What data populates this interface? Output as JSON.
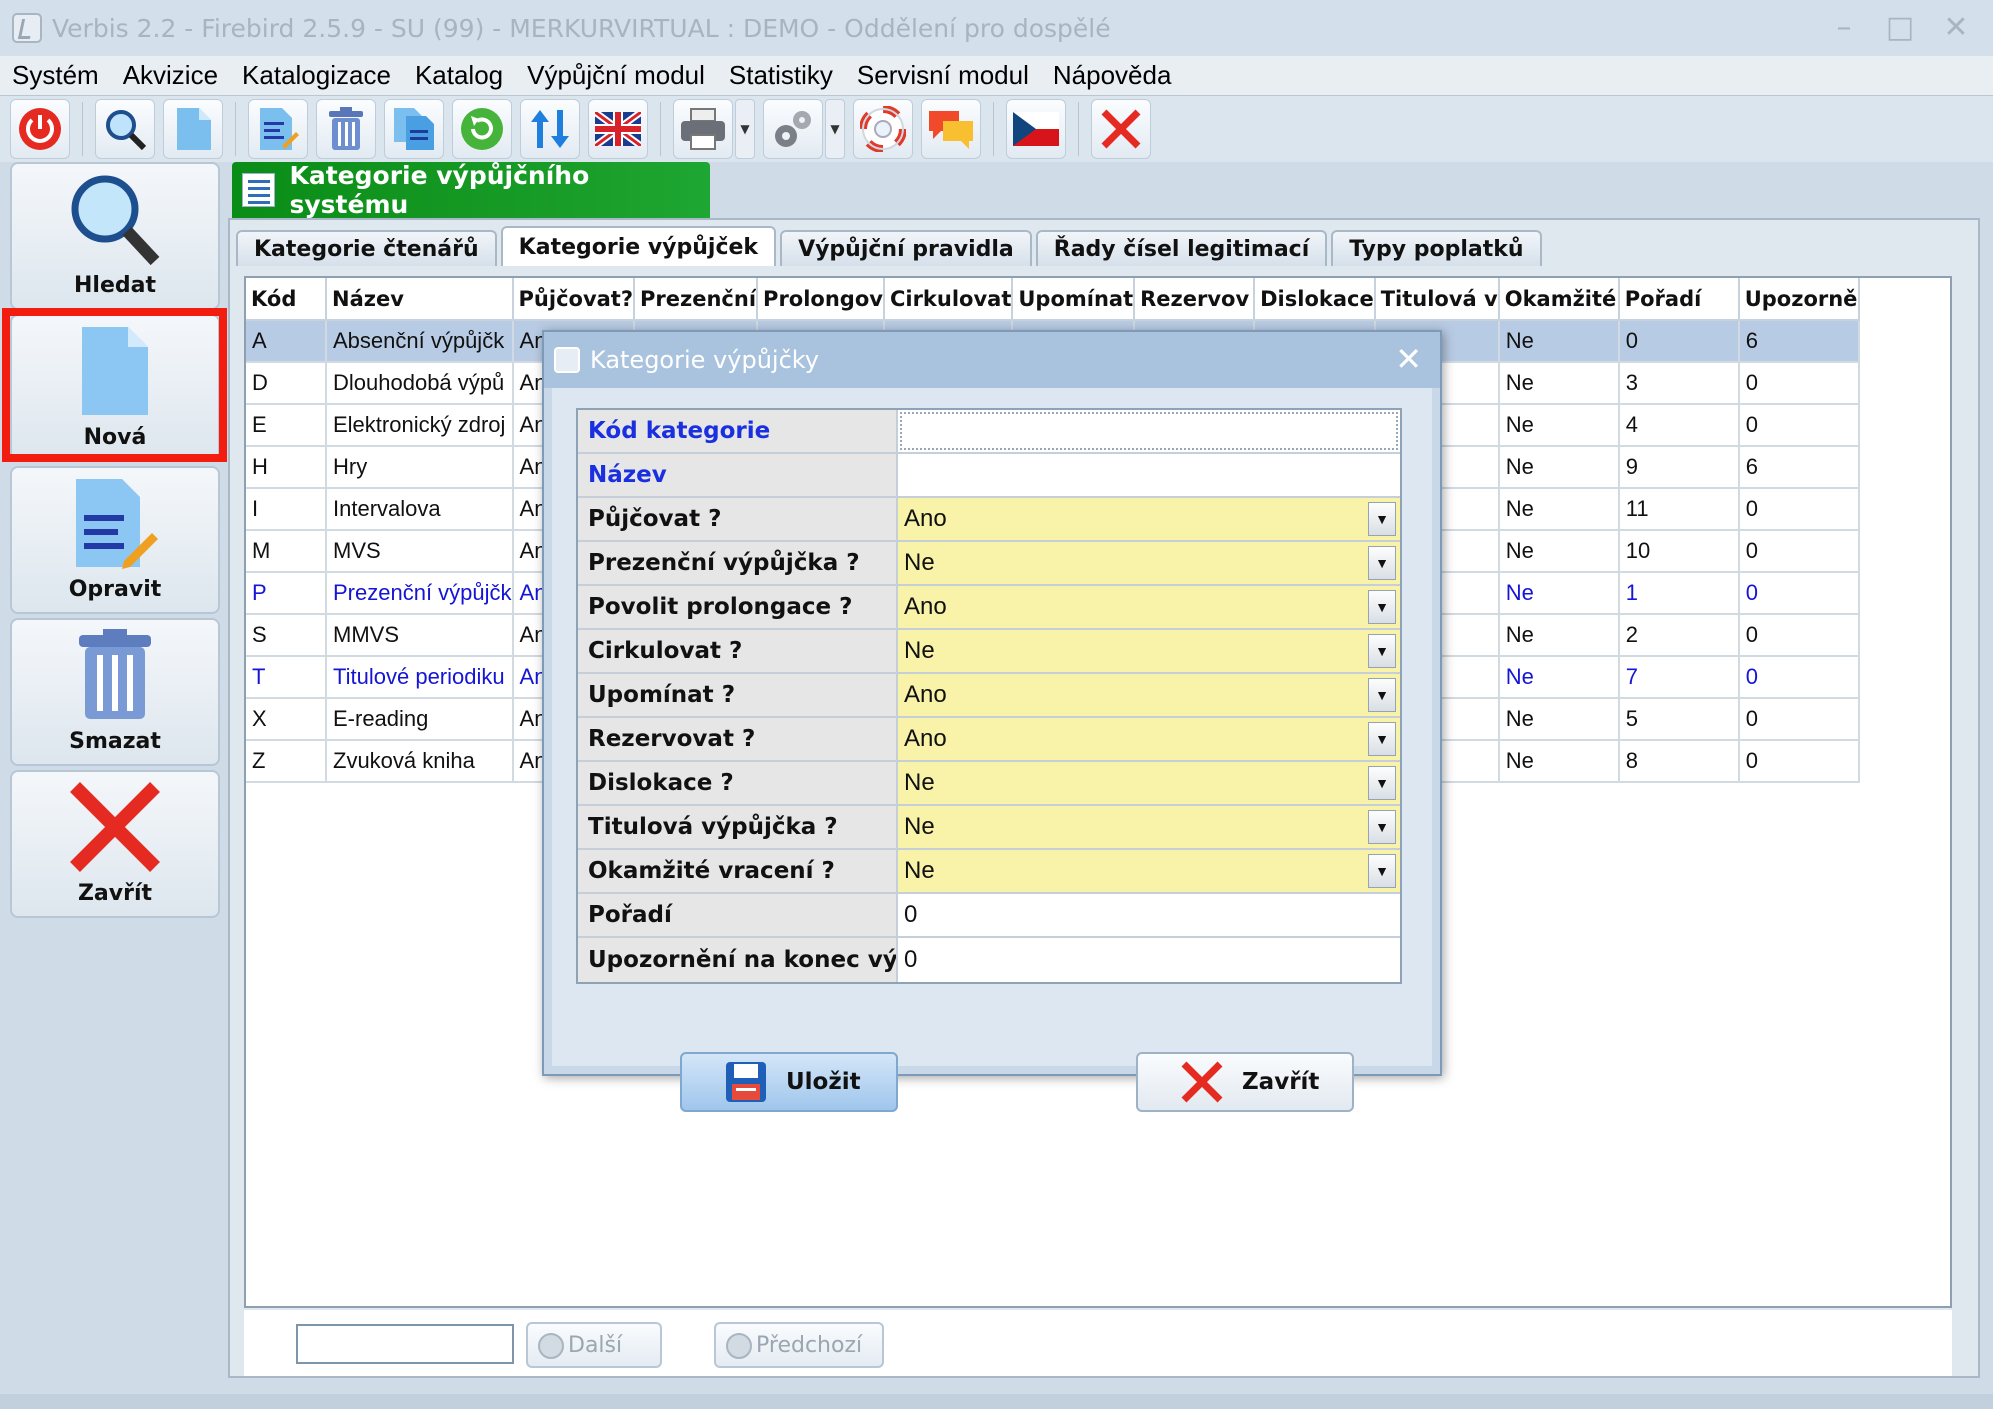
{
  "window": {
    "title": "Verbis 2.2 - Firebird 2.5.9 - SU (99) - MERKURVIRTUAL : DEMO - Oddělení pro dospělé"
  },
  "menu": [
    "Systém",
    "Akvizice",
    "Katalogizace",
    "Katalog",
    "Výpůjční modul",
    "Statistiky",
    "Servisní modul",
    "Nápověda"
  ],
  "toolbar": [
    "power-icon",
    "search-icon",
    "new-document-icon",
    "edit-icon",
    "trash-icon",
    "copy-icon",
    "refresh-icon",
    "sort-icon",
    "flag-uk-icon",
    "printer-icon",
    "settings-icon",
    "help-lifebuoy-icon",
    "messages-icon",
    "flag-cz-icon",
    "close-icon"
  ],
  "sidebar": {
    "search": "Hledat",
    "new": "Nová",
    "edit": "Opravit",
    "delete": "Smazat",
    "close": "Zavřít"
  },
  "page_title": "Kategorie výpůjčního systému",
  "tabs": [
    "Kategorie čtenářů",
    "Kategorie výpůjček",
    "Výpůjční pravidla",
    "Řady čísel legitimací",
    "Typy poplatků"
  ],
  "active_tab": "Kategorie výpůjček",
  "grid": {
    "headers": [
      "Kód",
      "Název",
      "Půjčovat?",
      "Prezenční",
      "Prolongov",
      "Cirkulovat",
      "Upomínat",
      "Rezervov",
      "Dislokace",
      "Titulová v",
      "Okamžité",
      "Pořadí",
      "Upozorně"
    ],
    "rows": [
      [
        "A",
        "Absenční výpůjčk",
        "Ano",
        "Ne",
        "0",
        "6"
      ],
      [
        "D",
        "Dlouhodobá výpů",
        "Ano",
        "Ne",
        "3",
        "0"
      ],
      [
        "E",
        "Elektronický zdroj",
        "Ano",
        "Ne",
        "4",
        "0"
      ],
      [
        "H",
        "Hry",
        "Ano",
        "Ne",
        "9",
        "6"
      ],
      [
        "I",
        "Intervalova",
        "Ano",
        "Ne",
        "11",
        "0"
      ],
      [
        "M",
        "MVS",
        "Ano",
        "Ne",
        "10",
        "0"
      ],
      [
        "P",
        "Prezenční výpůjčk",
        "Ano",
        "Ne",
        "1",
        "0"
      ],
      [
        "S",
        "MMVS",
        "Ano",
        "Ne",
        "2",
        "0"
      ],
      [
        "T",
        "Titulové periodiku",
        "Ano",
        "Ne",
        "7",
        "0"
      ],
      [
        "X",
        "E-reading",
        "Ano",
        "Ne",
        "5",
        "0"
      ],
      [
        "Z",
        "Zvuková kniha",
        "Ano",
        "Ne",
        "8",
        "0"
      ]
    ]
  },
  "nav": {
    "search_value": "",
    "next": "Další",
    "prev": "Předchozí"
  },
  "dialog": {
    "title": "Kategorie výpůjčky",
    "fields": [
      {
        "label": "Kód kategorie",
        "value": ""
      },
      {
        "label": "Název",
        "value": ""
      },
      {
        "label": "Půjčovat ?",
        "value": "Ano"
      },
      {
        "label": "Prezenční výpůjčka ?",
        "value": "Ne"
      },
      {
        "label": "Povolit prolongace ?",
        "value": "Ano"
      },
      {
        "label": "Cirkulovat ?",
        "value": "Ne"
      },
      {
        "label": "Upomínat ?",
        "value": "Ano"
      },
      {
        "label": "Rezervovat ?",
        "value": "Ano"
      },
      {
        "label": "Dislokace ?",
        "value": "Ne"
      },
      {
        "label": "Titulová výpůjčka ?",
        "value": "Ne"
      },
      {
        "label": "Okamžité vracení ?",
        "value": "Ne"
      },
      {
        "label": "Pořadí",
        "value": "0"
      },
      {
        "label": "Upozornění na konec výpůjčky",
        "value": "0"
      }
    ],
    "save": "Uložit",
    "close": "Zavřít"
  },
  "colors": {
    "accent_green": "#0a8d17",
    "highlight_red": "#f21d0f",
    "selected_row": "#b8cbe4",
    "combo_yellow": "#f8f3a8",
    "link_blue": "#1515d6"
  }
}
